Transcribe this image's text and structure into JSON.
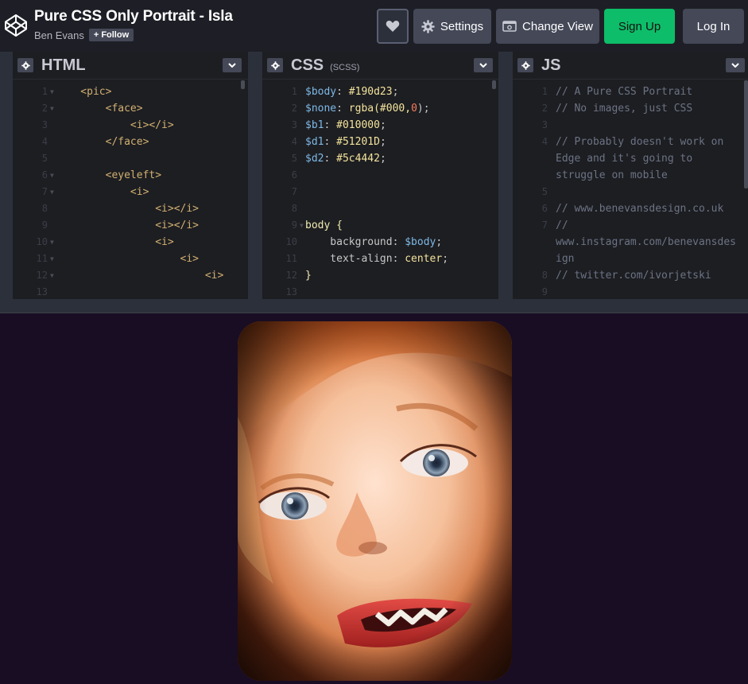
{
  "header": {
    "title": "Pure CSS Only Portrait - Isla",
    "author": "Ben Evans",
    "follow_label": "Follow",
    "follow_icon": "plus-icon",
    "buttons": {
      "heart_icon": "heart-icon",
      "settings_label": "Settings",
      "settings_icon": "gear-icon",
      "change_view_label": "Change View",
      "change_view_icon": "layout-icon",
      "signup_label": "Sign Up",
      "login_label": "Log In"
    }
  },
  "panes": {
    "html": {
      "name": "HTML",
      "lines": [
        {
          "n": "1",
          "fold": true,
          "text": "    <pic>"
        },
        {
          "n": "2",
          "fold": true,
          "text": "        <face>"
        },
        {
          "n": "3",
          "fold": false,
          "text": "            <i></i>"
        },
        {
          "n": "4",
          "fold": false,
          "text": "        </face>"
        },
        {
          "n": "5",
          "fold": false,
          "text": ""
        },
        {
          "n": "6",
          "fold": true,
          "text": "        <eyeleft>"
        },
        {
          "n": "7",
          "fold": true,
          "text": "            <i>"
        },
        {
          "n": "8",
          "fold": false,
          "text": "                <i></i>"
        },
        {
          "n": "9",
          "fold": false,
          "text": "                <i></i>"
        },
        {
          "n": "10",
          "fold": true,
          "text": "                <i>"
        },
        {
          "n": "11",
          "fold": true,
          "text": "                    <i>"
        },
        {
          "n": "12",
          "fold": true,
          "text": "                        <i>"
        },
        {
          "n": "13",
          "fold": false,
          "text": ""
        }
      ]
    },
    "css": {
      "name": "CSS",
      "sub": "(SCSS)",
      "lines": [
        {
          "n": "1",
          "var": "$body",
          "val": " #190d23",
          "end": ";"
        },
        {
          "n": "2",
          "var": "$none",
          "val": " rgba(#000,",
          "num": "0",
          "end": ");"
        },
        {
          "n": "3",
          "var": "$b1",
          "val": " #010000",
          "end": ";"
        },
        {
          "n": "4",
          "var": "$d1",
          "val": " #51201D",
          "end": ";"
        },
        {
          "n": "5",
          "var": "$d2",
          "val": " #5c4442",
          "end": ";"
        },
        {
          "n": "6"
        },
        {
          "n": "7"
        },
        {
          "n": "8"
        },
        {
          "n": "9",
          "sel": "body {",
          "fold": true
        },
        {
          "n": "10",
          "prop": "    background",
          "var2": " $body",
          "end2": ";"
        },
        {
          "n": "11",
          "prop": "    text-align",
          "val2": " center",
          "end2": ";"
        },
        {
          "n": "12",
          "sel": "}"
        },
        {
          "n": "13"
        }
      ]
    },
    "js": {
      "name": "JS",
      "lines": [
        {
          "n": "1",
          "text": "// A Pure CSS Portrait"
        },
        {
          "n": "2",
          "text": "// No images, just CSS"
        },
        {
          "n": "3",
          "text": ""
        },
        {
          "n": "4",
          "text": "// Probably doesn't work on"
        },
        {
          "n": "",
          "text": "Edge and it's going to"
        },
        {
          "n": "",
          "text": "struggle on mobile"
        },
        {
          "n": "5",
          "text": ""
        },
        {
          "n": "6",
          "text": "// www.benevansdesign.co.uk"
        },
        {
          "n": "7",
          "text": "//"
        },
        {
          "n": "",
          "text": "www.instagram.com/benevansdes"
        },
        {
          "n": "",
          "text": "ign"
        },
        {
          "n": "8",
          "text": "// twitter.com/ivorjetski"
        },
        {
          "n": "9",
          "text": ""
        }
      ]
    }
  },
  "preview": {
    "background": "#190d23",
    "portrait_alt": "portrait-painting"
  },
  "colors": {
    "signup": "#0ebd69",
    "header_bg": "#1e1f26",
    "button_bg": "#444857"
  }
}
